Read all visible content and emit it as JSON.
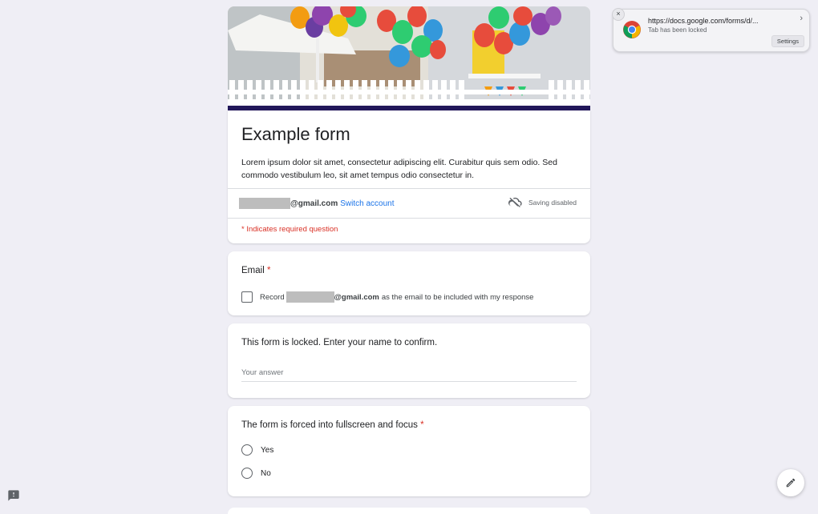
{
  "form": {
    "title": "Example form",
    "description": "Lorem ipsum dolor sit amet, consectetur adipiscing elit. Curabitur quis sem odio. Sed commodo vestibulum leo, sit amet tempus odio consectetur in.",
    "account_email_suffix": "@gmail.com",
    "switch_account": "Switch account",
    "saving_status": "Saving disabled",
    "required_note": "* Indicates required question"
  },
  "questions": {
    "email": {
      "label": "Email",
      "required_mark": "*",
      "checkbox_prefix": "Record",
      "checkbox_email_suffix": "@gmail.com",
      "checkbox_rest": "as the email to be included with my response"
    },
    "locked": {
      "label": "This form is locked. Enter your name to confirm.",
      "placeholder": "Your answer"
    },
    "fullscreen": {
      "label": "The form is forced into fullscreen and focus",
      "required_mark": "*",
      "options": [
        "Yes",
        "No"
      ]
    }
  },
  "notification": {
    "url": "https://docs.google.com/forms/d/...",
    "message": "Tab has been locked",
    "settings": "Settings",
    "close_symbol": "×",
    "chevron_symbol": "›"
  },
  "colors": {
    "accent": "#22175a",
    "required": "#d93025",
    "link": "#1a73e8",
    "background": "#efeef5"
  },
  "icons": [
    "chrome-icon",
    "cloud-off-icon",
    "pencil-icon",
    "feedback-icon",
    "close-icon",
    "chevron-right-icon"
  ]
}
